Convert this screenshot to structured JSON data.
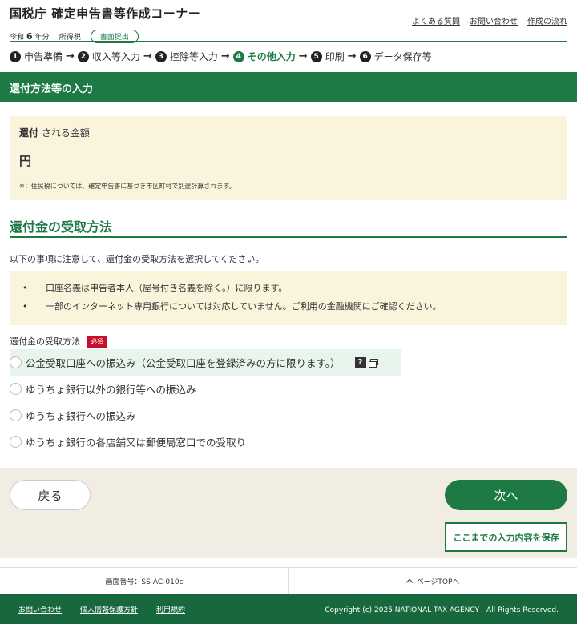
{
  "header": {
    "title": "国税庁 確定申告書等作成コーナー",
    "era": "令和",
    "year": "6",
    "year_suffix": "年分",
    "tax_type": "所得税",
    "submit_badge": "書面提出",
    "links": [
      "よくある質問",
      "お問い合わせ",
      "作成の流れ"
    ]
  },
  "steps": [
    {
      "num": "1",
      "label": "申告準備"
    },
    {
      "num": "2",
      "label": "収入等入力"
    },
    {
      "num": "3",
      "label": "控除等入力"
    },
    {
      "num": "4",
      "label": "その他入力",
      "active": true
    },
    {
      "num": "5",
      "label": "印刷"
    },
    {
      "num": "6",
      "label": "データ保存等"
    }
  ],
  "section_title": "還付方法等の入力",
  "refund": {
    "title_bold": "還付",
    "title_rest": " される金額",
    "amount_unit": "円",
    "note": "※：住民税については、確定申告書に基づき市区町村で別途計算されます。"
  },
  "method_heading": "還付金の受取方法",
  "lead_text": "以下の事項に注意して、還付金の受取方法を選択してください。",
  "notices": [
    "口座名義は申告者本人（屋号付き名義を除く。）に限ります。",
    "一部のインターネット専用銀行については対応していません。ご利用の金融機関にご確認ください。"
  ],
  "field_label": "還付金の受取方法",
  "required_badge": "必須",
  "options": [
    "公金受取口座への振込み（公金受取口座を登録済みの方に限ります。）",
    "ゆうちょ銀行以外の銀行等への振込み",
    "ゆうちょ銀行への振込み",
    "ゆうちょ銀行の各店舗又は郵便局窓口での受取り"
  ],
  "help_icon_glyph": "?",
  "buttons": {
    "back": "戻る",
    "next": "次へ",
    "save": "ここまでの入力内容を保存"
  },
  "screen_id": "画面番号：SS-AC-010c",
  "page_top": "ページTOPへ",
  "footer": {
    "links": [
      "お問い合わせ",
      "個人情報保護方針",
      "利用規約"
    ],
    "copyright": "Copyright (c) 2025 NATIONAL TAX AGENCY　All Rights Reserved."
  },
  "colors": {
    "brand_green": "#1d7a45",
    "notice_bg": "#fbf4dd",
    "required_red": "#c8102e"
  }
}
